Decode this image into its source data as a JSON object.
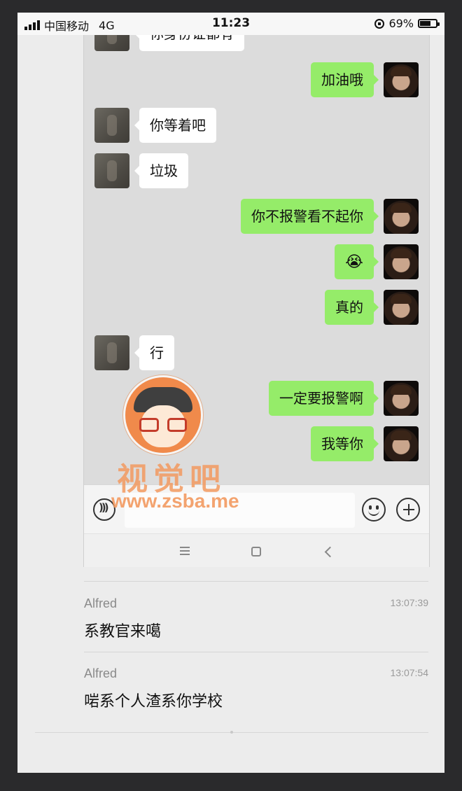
{
  "status_bar": {
    "carrier": "中国移动",
    "network": "4G",
    "time": "11:23",
    "battery": "69%",
    "battery_level": 0.69
  },
  "chat": {
    "partial_top_message": "你身份证都有",
    "messages": [
      {
        "from": "me",
        "text": "加油哦"
      },
      {
        "from": "other",
        "text": "你等着吧"
      },
      {
        "from": "other",
        "text": "垃圾"
      },
      {
        "from": "me",
        "text": "你不报警看不起你"
      },
      {
        "from": "me",
        "text": "😭"
      },
      {
        "from": "me",
        "text": "真的"
      },
      {
        "from": "other",
        "text": "行"
      },
      {
        "from": "me",
        "text": "一定要报警啊"
      },
      {
        "from": "me",
        "text": "我等你"
      }
    ]
  },
  "watermark": {
    "title": "视觉吧",
    "url": "www.zsba.me"
  },
  "comments": [
    {
      "name": "Alfred",
      "time": "13:07:39",
      "text": "系教官来噶"
    },
    {
      "name": "Alfred",
      "time": "13:07:54",
      "text": "啱系个人渣系你学校"
    }
  ],
  "colors": {
    "my_bubble": "#95ec69",
    "other_bubble": "#ffffff",
    "chat_bg": "#dcdcdc",
    "watermark": "#f39a60"
  }
}
